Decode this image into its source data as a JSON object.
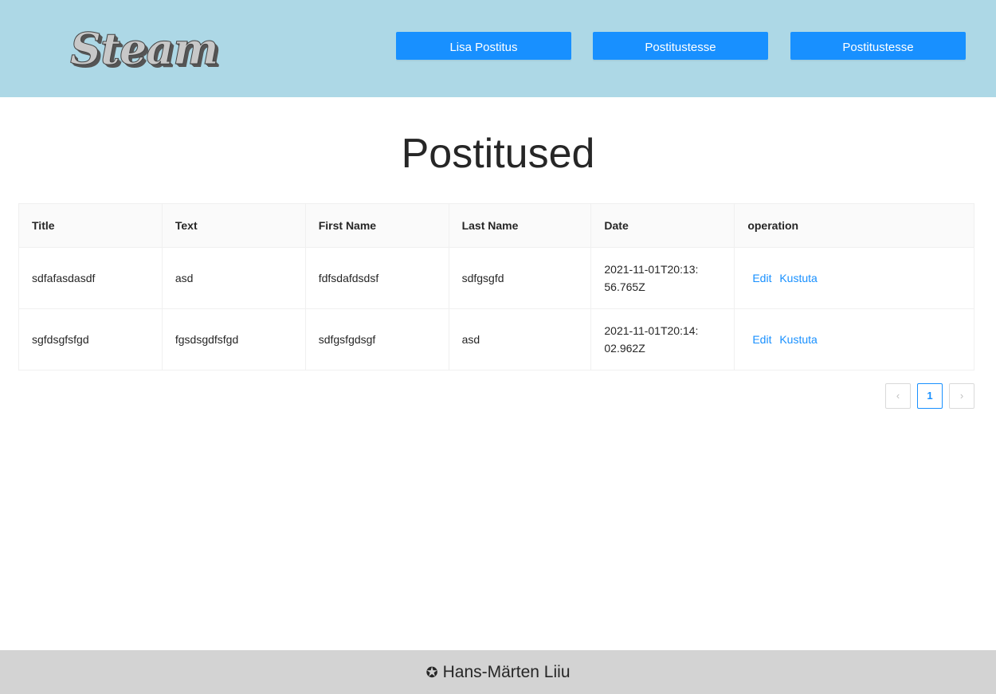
{
  "header": {
    "logo_text": "Steam",
    "nav": [
      {
        "label": "Lisa Postitus"
      },
      {
        "label": "Postitustesse"
      },
      {
        "label": "Postitustesse"
      }
    ]
  },
  "main": {
    "title": "Postitused",
    "table": {
      "columns": [
        "Title",
        "Text",
        "First Name",
        "Last Name",
        "Date",
        "operation"
      ],
      "rows": [
        {
          "title": "sdfafasdasdf",
          "text": "asd",
          "first_name": "fdfsdafdsdsf",
          "last_name": "sdfgsgfd",
          "date": "2021-11-01T20:13:56.765Z",
          "edit_label": "Edit",
          "delete_label": "Kustuta"
        },
        {
          "title": "sgfdsgfsfgd",
          "text": "fgsdsgdfsfgd",
          "first_name": "sdfgsfgdsgf",
          "last_name": "asd",
          "date": "2021-11-01T20:14:02.962Z",
          "edit_label": "Edit",
          "delete_label": "Kustuta"
        }
      ]
    },
    "pagination": {
      "prev_icon": "‹",
      "current_page": "1",
      "next_icon": "›"
    }
  },
  "footer": {
    "icon": "✪",
    "text": "Hans-Märten Liiu"
  },
  "colors": {
    "header_bg": "#add8e6",
    "primary": "#1890ff",
    "footer_bg": "#d3d3d3"
  }
}
